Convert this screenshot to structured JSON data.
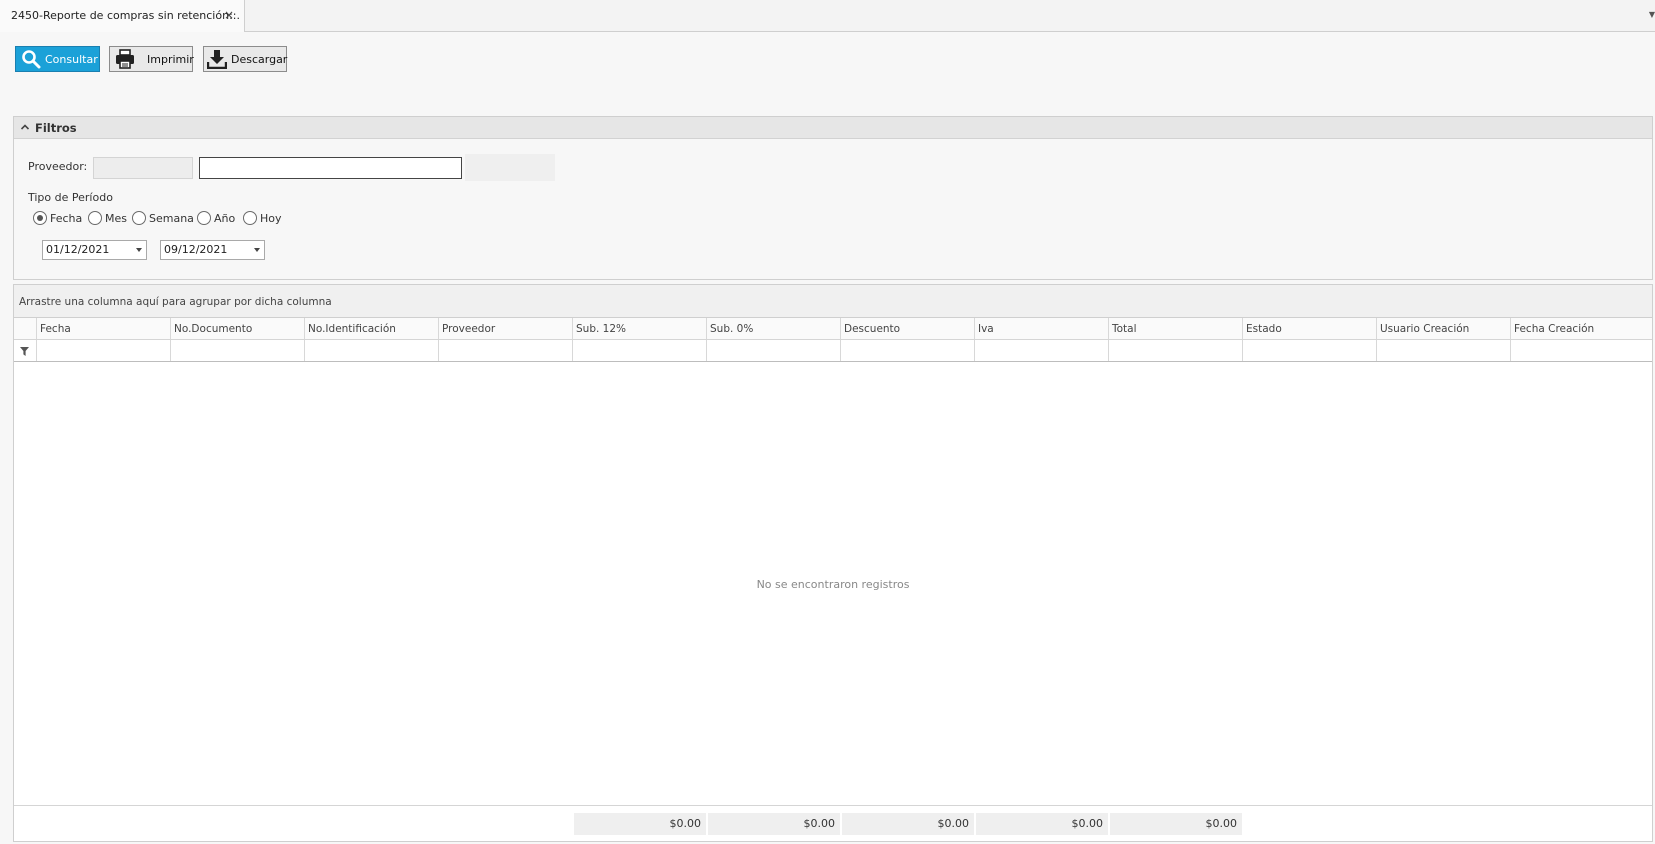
{
  "tab": {
    "title": "2450-Reporte de compras sin retención::.",
    "close": "×"
  },
  "toolbar": {
    "consultar_label": "Consultar",
    "imprimir_label": "Imprimir",
    "descargar_label": "Descargar"
  },
  "filters": {
    "title": "Filtros",
    "proveedor_label": "Proveedor:",
    "proveedor_code": "",
    "proveedor_name": "",
    "tipo_periodo_label": "Tipo de Período",
    "periodo_options": [
      "Fecha",
      "Mes",
      "Semana",
      "Año",
      "Hoy"
    ],
    "periodo_selected": "Fecha",
    "fecha_desde": "01/12/2021",
    "fecha_hasta": "09/12/2021"
  },
  "grid": {
    "group_hint": "Arrastre una columna aquí para agrupar por dicha columna",
    "columns": [
      "Fecha",
      "No.Documento",
      "No.Identificación",
      "Proveedor",
      "Sub. 12%",
      "Sub. 0%",
      "Descuento",
      "Iva",
      "Total",
      "Estado",
      "Usuario Creación",
      "Fecha Creación"
    ],
    "empty_message": "No se encontraron registros",
    "totals": [
      "$0.00",
      "$0.00",
      "$0.00",
      "$0.00",
      "$0.00"
    ]
  }
}
